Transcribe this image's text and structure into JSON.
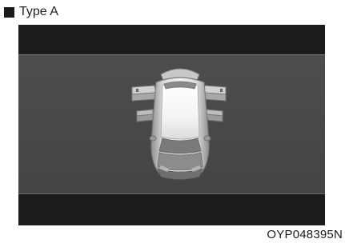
{
  "caption": {
    "square_icon": "black-square",
    "label": "Type A"
  },
  "display": {
    "state": "all-doors-open",
    "colors": {
      "band": "#1c1c1c",
      "screen": "#4a4a4a",
      "body": "#d9d9d9",
      "outline": "#9b9b9b"
    }
  },
  "image_code": "OYP048395N"
}
